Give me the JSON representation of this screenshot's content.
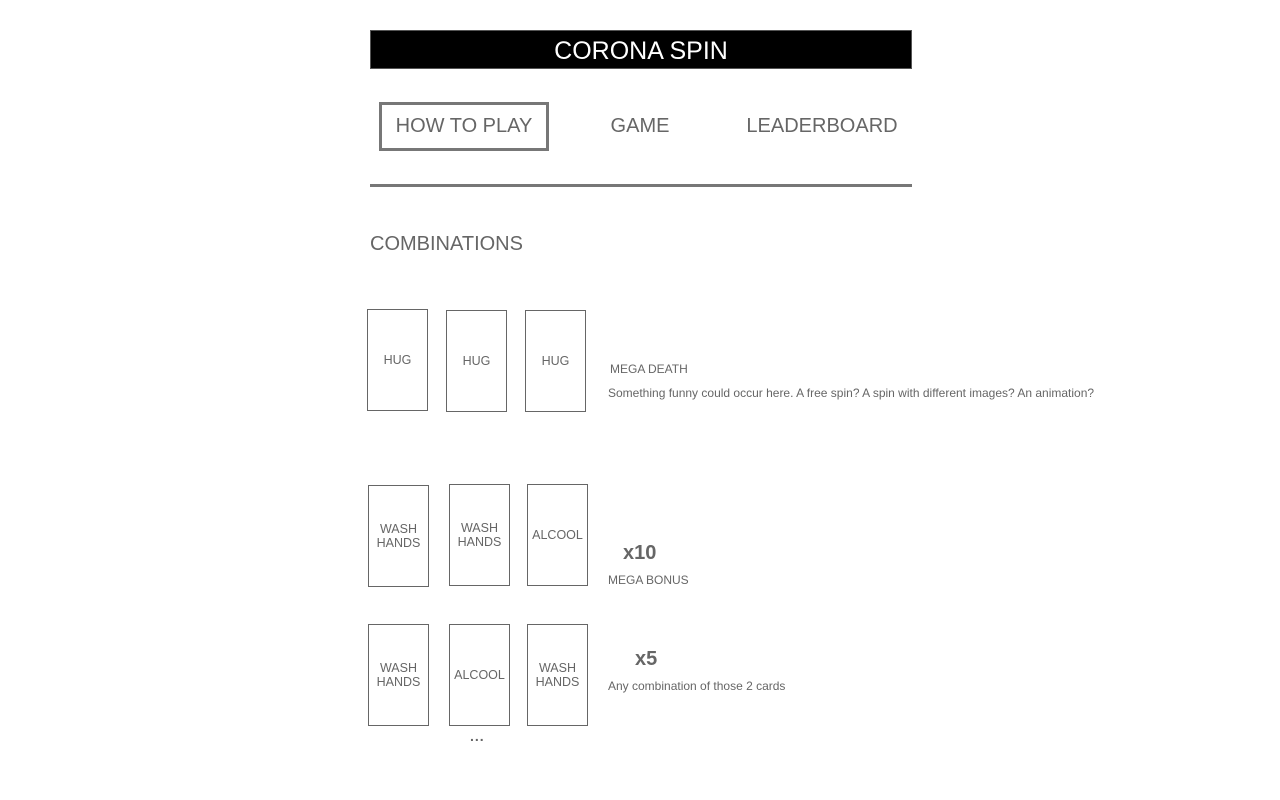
{
  "header": {
    "title": "CORONA SPIN"
  },
  "nav": {
    "tabs": [
      {
        "label": "HOW TO PLAY",
        "active": true
      },
      {
        "label": "GAME",
        "active": false
      },
      {
        "label": "LEADERBOARD",
        "active": false
      }
    ]
  },
  "main": {
    "section_title": "COMBINATIONS",
    "combos": [
      {
        "cards": [
          "HUG",
          "HUG",
          "HUG"
        ],
        "multiplier": "",
        "name": "MEGA DEATH",
        "description": "Something funny could occur here. A free spin? A spin with different images? An animation?"
      },
      {
        "cards": [
          "WASH\nHANDS",
          "WASH\nHANDS",
          "ALCOOL"
        ],
        "multiplier": "x10",
        "name": "MEGA BONUS",
        "description": ""
      },
      {
        "cards": [
          "WASH\nHANDS",
          "ALCOOL",
          "WASH\nHANDS"
        ],
        "multiplier": "x5",
        "name": "",
        "description": "Any combination of those 2 cards"
      }
    ],
    "more_indicator": "..."
  },
  "colors": {
    "title_bg": "#000000",
    "title_text": "#ffffff",
    "text": "#666666",
    "border": "#777777"
  }
}
